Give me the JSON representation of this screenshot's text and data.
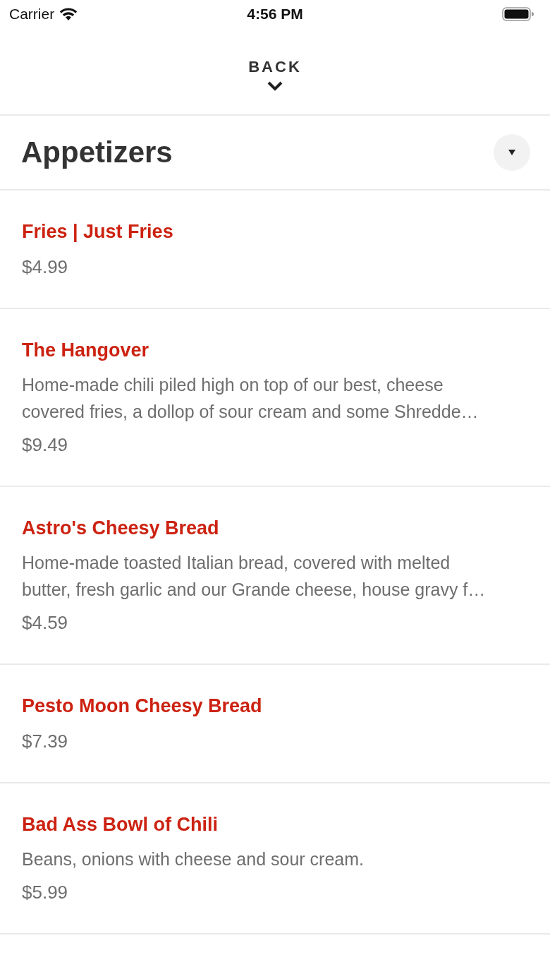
{
  "status_bar": {
    "carrier": "Carrier",
    "time": "4:56 PM"
  },
  "header": {
    "back_label": "BACK"
  },
  "section": {
    "title": "Appetizers",
    "expanded": true
  },
  "items": [
    {
      "name": "Fries | Just Fries",
      "price": "$4.99"
    },
    {
      "name": "The Hangover",
      "description_lines": [
        "Home-made chili piled high on top of our best, cheese",
        "covered fries, a dollop of sour cream and some Shredde…"
      ],
      "price": "$9.49"
    },
    {
      "name": "Astro's Cheesy Bread",
      "description_lines": [
        "Home-made toasted Italian bread, covered with melted",
        "butter, fresh garlic and our Grande cheese, house gravy f…"
      ],
      "price": "$4.59"
    },
    {
      "name": "Pesto Moon Cheesy Bread",
      "price": "$7.39"
    },
    {
      "name": "Bad Ass Bowl of Chili",
      "description_lines": [
        "Beans, onions with cheese and sour cream."
      ],
      "price": "$5.99"
    }
  ]
}
